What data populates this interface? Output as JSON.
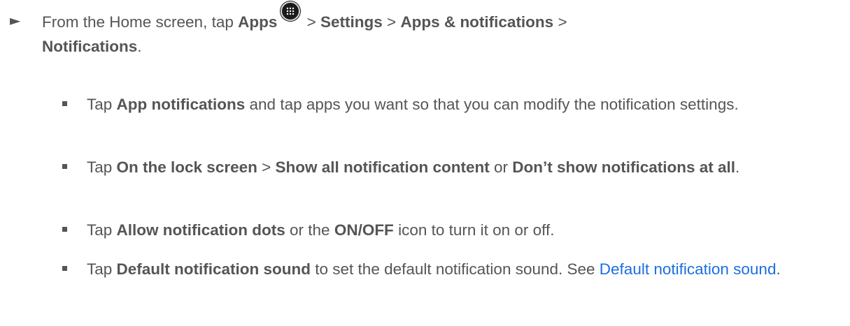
{
  "step": {
    "arrow": "►",
    "from_text": "From the Home screen, tap ",
    "apps": "Apps",
    "sep1": " > ",
    "settings": "Settings",
    "sep2": " > ",
    "apps_notifications": "Apps & notifications",
    "sep3": " > ",
    "notifications": "Notifications",
    "period": "."
  },
  "bullets": {
    "b1": {
      "tap": "Tap ",
      "bold1": "App notifications",
      "rest": " and tap apps you want so that you can modify the notification settings."
    },
    "b2": {
      "tap": "Tap ",
      "bold1": "On the lock screen",
      "sep": " > ",
      "bold2": "Show all notification content",
      "or": " or ",
      "bold3": "Don’t show notifications at all",
      "period": "."
    },
    "b3": {
      "tap": "Tap ",
      "bold1": "Allow notification dots",
      "or": " or the ",
      "bold2": "ON/OFF",
      "rest": " icon to turn it on or off."
    },
    "b4": {
      "tap": "Tap ",
      "bold1": "Default notification sound",
      "rest": " to set the default notification sound. See ",
      "link": "Default notification sound",
      "period": "."
    }
  }
}
